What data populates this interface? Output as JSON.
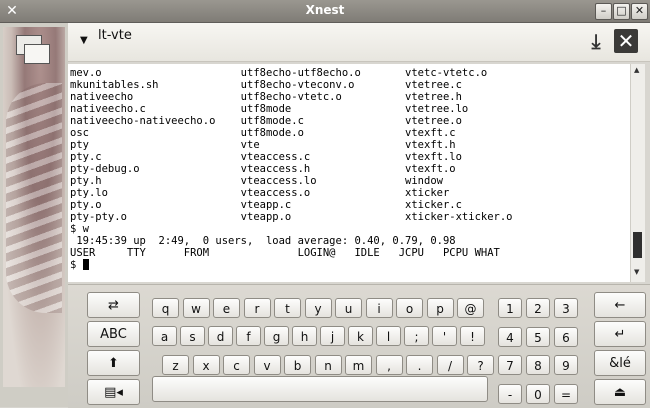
{
  "window": {
    "title": "Xnest",
    "controls": [
      "minimize",
      "maximize",
      "close"
    ]
  },
  "app": {
    "title": "lt-vte",
    "header_buttons": [
      "download-icon",
      "close-icon"
    ]
  },
  "terminal": {
    "lines": [
      "mev.o                      utf8echo-utf8echo.o       vtetc-vtetc.o",
      "mkunitables.sh             utf8echo-vteconv.o        vtetree.c",
      "nativeecho                 utf8echo-vtetc.o          vtetree.h",
      "nativeecho.c               utf8mode                  vtetree.lo",
      "nativeecho-nativeecho.o    utf8mode.c                vtetree.o",
      "osc                        utf8mode.o                vtexft.c",
      "pty                        vte                       vtexft.h",
      "pty.c                      vteaccess.c               vtexft.lo",
      "pty-debug.o                vteaccess.h               vtexft.o",
      "pty.h                      vteaccess.lo              window",
      "pty.lo                     vteaccess.o               xticker",
      "pty.o                      vteapp.c                  xticker.c",
      "pty-pty.o                  vteapp.o                  xticker-xticker.o",
      "$ w",
      " 19:45:39 up  2:49,  0 users,  load average: 0.40, 0.79, 0.98",
      "USER     TTY      FROM              LOGIN@   IDLE   JCPU   PCPU WHAT"
    ],
    "prompt": "$ "
  },
  "keyboard": {
    "left_keys": [
      "tab-icon",
      "ABC",
      "shift-icon",
      "menu-icon"
    ],
    "row1": [
      "q",
      "w",
      "e",
      "r",
      "t",
      "y",
      "u",
      "i",
      "o",
      "p",
      "@"
    ],
    "row2": [
      "a",
      "s",
      "d",
      "f",
      "g",
      "h",
      "j",
      "k",
      "l",
      ";",
      "'",
      "!"
    ],
    "row3": [
      "z",
      "x",
      "c",
      "v",
      "b",
      "n",
      "m",
      ",",
      ".",
      "/",
      "?"
    ],
    "numpad": [
      "1",
      "2",
      "3",
      "4",
      "5",
      "6",
      "7",
      "8",
      "9",
      "-",
      "0",
      "="
    ],
    "right_keys": [
      "backspace-icon",
      "enter-icon",
      "&lé",
      "hide-keyboard-icon"
    ]
  }
}
